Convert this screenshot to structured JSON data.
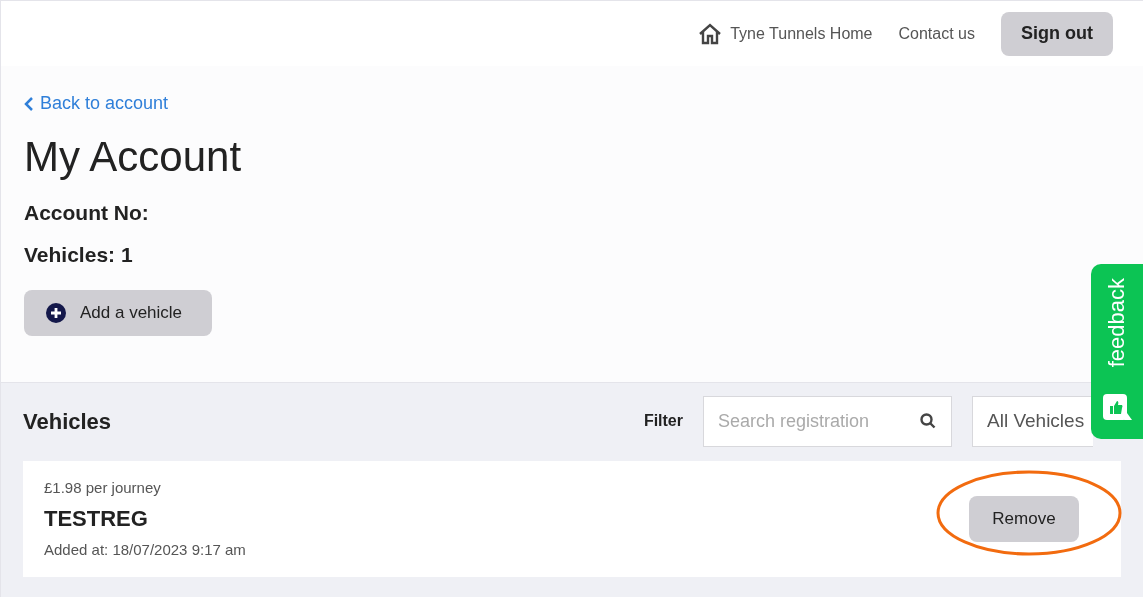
{
  "header": {
    "nav": [
      {
        "label": "Tyne Tunnels Home",
        "kind": "home"
      },
      {
        "label": "Contact us",
        "kind": "plain"
      }
    ],
    "sign_out": "Sign out"
  },
  "back_link": "Back to account",
  "title": "My Account",
  "account_no_label": "Account No:",
  "vehicles_count": "Vehicles: 1",
  "add_vehicle": "Add a vehicle",
  "vehicles_section": {
    "heading": "Vehicles",
    "filter_label": "Filter",
    "search": {
      "placeholder": "Search registration"
    },
    "dropdown": {
      "value": "All Vehicles"
    },
    "items": [
      {
        "price": "£1.98 per journey",
        "registration": "TESTREG",
        "added": "Added at: 18/07/2023 9:17 am",
        "action": "Remove",
        "highlighted": true
      }
    ]
  },
  "feedback_tab": "feedback"
}
